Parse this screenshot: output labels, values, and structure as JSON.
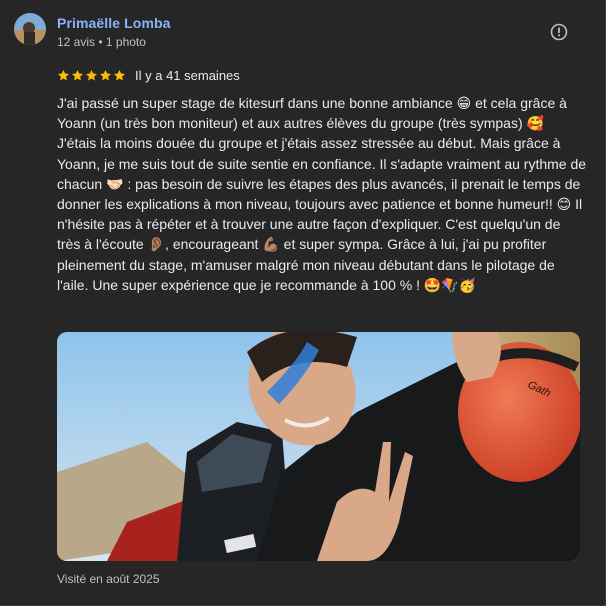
{
  "review": {
    "author_name": "Primaëlle Lomba",
    "author_meta": "12 avis • 1 photo",
    "rating": 5,
    "rating_max": 5,
    "star_color": "#fbbc04",
    "time_ago": "Il y a 41 semaines",
    "text": "J'ai passé un super stage de kitesurf dans une bonne ambiance 😁 et cela grâce à Yoann (un très bon moniteur) et aux autres élèves du groupe (très sympas) 🥰 J'étais la moins douée du groupe et j'étais assez stressée au début. Mais grâce à Yoann, je me suis tout de suite sentie en confiance. Il s'adapte vraiment au rythme de chacun 🤝🏻 : pas besoin de suivre les étapes des plus avancés, il prenait le temps de donner les explications à mon niveau, toujours avec patience et bonne humeur!! 😊 Il n'hésite pas à répéter et à trouver une autre façon d'expliquer. C'est quelqu'un de très à l'écoute 👂🏽, encourageant 💪🏽 et super sympa. Grâce à lui, j'ai pu profiter pleinement du stage, m'amuser malgré mon niveau débutant dans le pilotage de l'aile. Une super expérience que je recommande à 100 % ! 🤩🪁🥳",
    "visit_date": "Visité en août 2025",
    "photo_helmet_text": "Gath"
  },
  "icons": {
    "more": "alert-circle-icon",
    "star": "star-icon",
    "avatar": "user-avatar"
  },
  "colors": {
    "background": "#262627",
    "author_link": "#8ab4f8",
    "text_primary": "#e8eaed",
    "text_secondary": "#bdc1c6"
  }
}
